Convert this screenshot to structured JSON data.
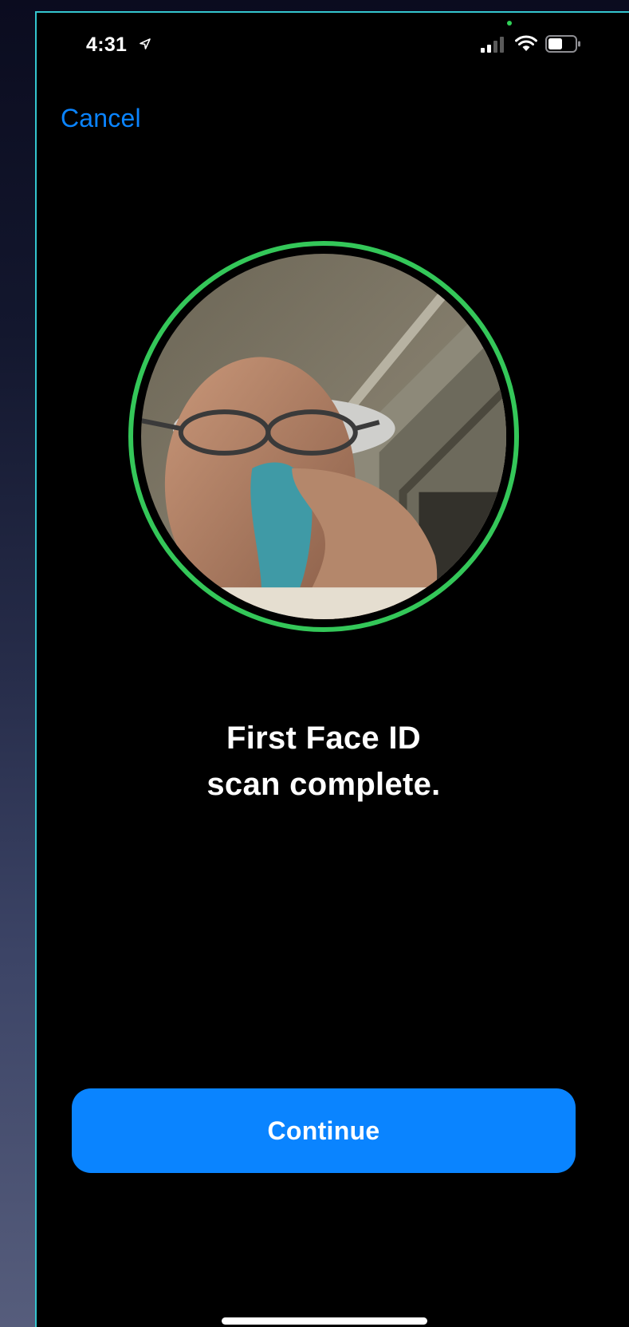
{
  "status_bar": {
    "time": "4:31",
    "icons": [
      "location-arrow-icon",
      "cellular-signal-icon",
      "wifi-icon",
      "battery-icon"
    ]
  },
  "navigation": {
    "cancel_label": "Cancel"
  },
  "scan": {
    "ring_color": "#34c759",
    "preview": "front-camera-face-preview",
    "message_line1": "First Face ID",
    "message_line2": "scan complete."
  },
  "actions": {
    "continue_label": "Continue",
    "accent_color": "#0a84ff"
  }
}
